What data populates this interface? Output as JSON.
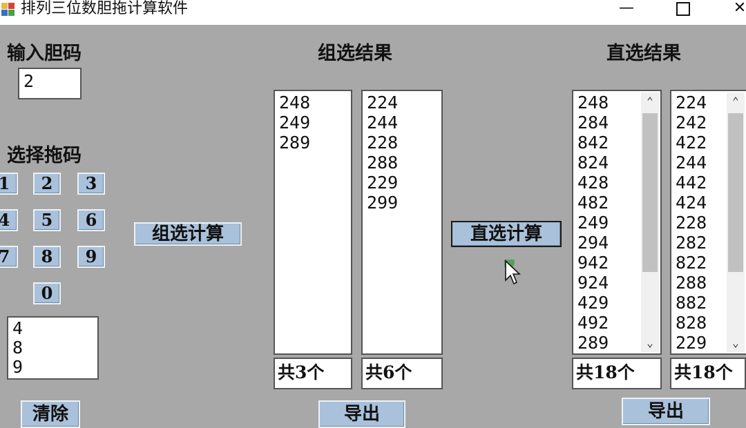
{
  "window": {
    "title": "排列三位数胆拖计算软件",
    "minimize": "—",
    "close": "✕"
  },
  "left": {
    "dan_label": "输入胆码",
    "dan_value": "2",
    "tuo_label": "选择拖码",
    "digits": [
      "1",
      "2",
      "3",
      "4",
      "5",
      "6",
      "7",
      "8",
      "9",
      "0"
    ],
    "selected_tuo": [
      "4",
      "8",
      "9"
    ],
    "clear_button": "清除"
  },
  "group": {
    "calc_button": "组选计算",
    "title": "组选结果",
    "list1": [
      "248",
      "249",
      "289"
    ],
    "list2": [
      "224",
      "244",
      "228",
      "288",
      "229",
      "299"
    ],
    "count1": "共3个",
    "count2": "共6个",
    "export_button": "导出"
  },
  "direct": {
    "calc_button": "直选计算",
    "title": "直选结果",
    "list1": [
      "248",
      "284",
      "842",
      "824",
      "428",
      "482",
      "249",
      "294",
      "942",
      "924",
      "429",
      "492",
      "289"
    ],
    "list2": [
      "224",
      "242",
      "422",
      "244",
      "442",
      "424",
      "228",
      "282",
      "822",
      "288",
      "882",
      "828",
      "229"
    ],
    "count1": "共18个",
    "count2": "共18个",
    "export_button": "导出"
  }
}
